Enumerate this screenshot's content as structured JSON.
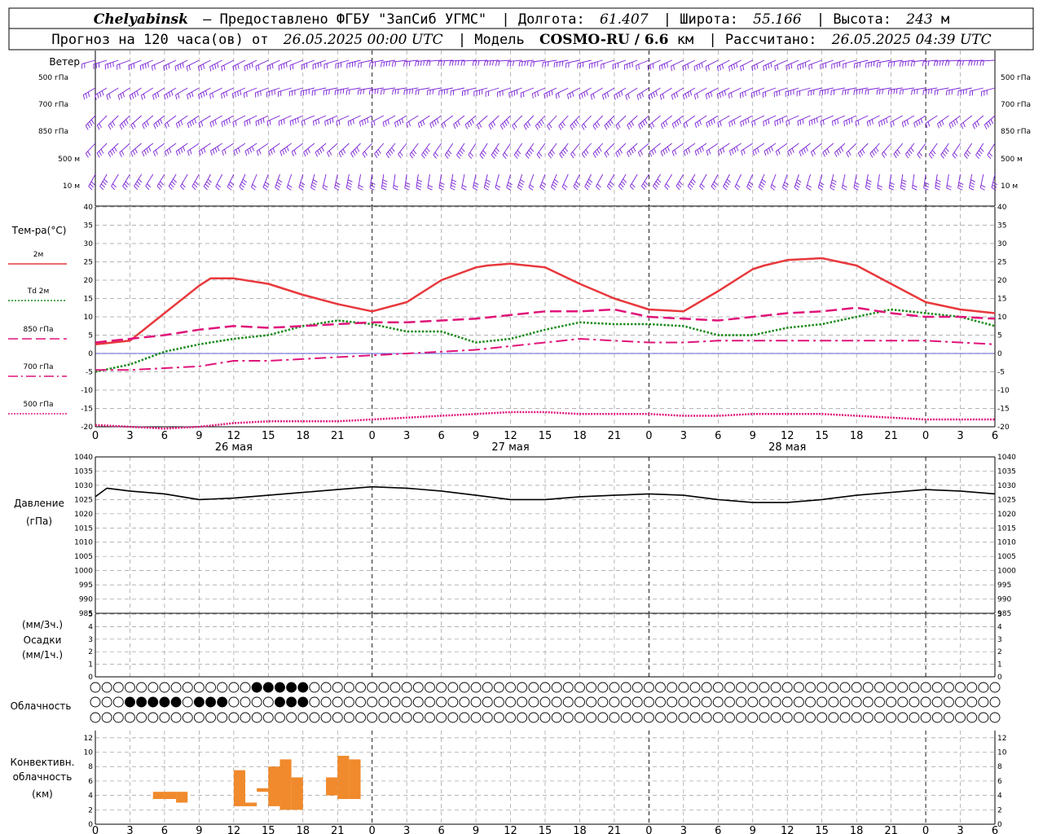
{
  "header": {
    "line1": {
      "station": "Chelyabinsk",
      "provided": "— Предоставлено ФГБУ \"ЗапСиб УГМС\"",
      "lon_label": "| Долгота:",
      "lon": "61.407",
      "lat_label": "| Широта:",
      "lat": "55.166",
      "alt_label": "| Высота:",
      "alt": "243",
      "alt_unit": "м"
    },
    "line2": {
      "forecast": "Прогноз на 120 часа(ов) от",
      "init": "26.05.2025 00:00 UTC",
      "model_label": "| Модель",
      "model": "COSMO-RU / 6.6",
      "model_unit": "км",
      "calc_label": "| Рассчитано:",
      "calc": "26.05.2025 04:39 UTC"
    }
  },
  "panels": {
    "wind": {
      "title": "Ветер",
      "levels": [
        "500 гПа",
        "700 гПа",
        "850 гПа",
        "500 м",
        "10 м"
      ]
    },
    "temperature": {
      "title": "Тем-ра(°C)",
      "legend": [
        {
          "label": "2м",
          "color": "#e8383c",
          "dash": "solid"
        },
        {
          "label": "Td  2м",
          "color": "#1a8a1a",
          "dash": "dot"
        },
        {
          "label": "850 гПа",
          "color": "#e0147a",
          "dash": "longdash"
        },
        {
          "label": "700 гПа",
          "color": "#e0147a",
          "dash": "dashdot"
        },
        {
          "label": "500 гПа",
          "color": "#e0147a",
          "dash": "dense"
        }
      ]
    },
    "pressure": {
      "title": "Давление",
      "unit": "(гПа)"
    },
    "precip": {
      "title": "Осадки",
      "unit_top": "(мм/3ч.)",
      "unit_bottom": "(мм/1ч.)"
    },
    "clouds": {
      "title": "Облачность"
    },
    "convective": {
      "title_1": "Конвективн.",
      "title_2": "облачность",
      "unit": "(км)"
    }
  },
  "x_ticks": [
    "0",
    "3",
    "6",
    "9",
    "12",
    "15",
    "18",
    "21",
    "0",
    "3",
    "6",
    "9",
    "12",
    "15",
    "18",
    "21",
    "0",
    "3",
    "6",
    "9",
    "12",
    "15",
    "18",
    "21",
    "0",
    "3",
    "6"
  ],
  "x_dates": [
    "26 мая",
    "27 мая",
    "28 мая"
  ],
  "colors": {
    "wind": "#7a1fd6",
    "t2m": "#e8383c",
    "td": "#1a8a1a",
    "upper": "#e0147a",
    "pressure": "#000000",
    "conv": "#f08a2c",
    "zero": "#3333cc"
  },
  "chart_data": [
    {
      "type": "line",
      "title": "Тем-ра(°C)",
      "x_unit": "hours since 26.05.2025 00:00 UTC",
      "ylim": [
        -20,
        40
      ],
      "yticks": [
        -20,
        -15,
        -10,
        -5,
        0,
        5,
        10,
        15,
        20,
        25,
        30,
        35,
        40
      ],
      "grid": true,
      "series": [
        {
          "name": "2м",
          "x": [
            0,
            3,
            6,
            9,
            10,
            12,
            15,
            18,
            21,
            24,
            27,
            30,
            33,
            34,
            36,
            39,
            42,
            45,
            48,
            51,
            54,
            57,
            58,
            60,
            63,
            66,
            69,
            72,
            75,
            78
          ],
          "y": [
            2.5,
            3.5,
            11,
            18.5,
            20.5,
            20.5,
            19,
            16,
            13.5,
            11.5,
            14,
            20,
            23.5,
            24,
            24.5,
            23.5,
            19,
            15,
            12,
            11.5,
            17,
            23,
            24,
            25.5,
            26,
            24,
            19,
            14,
            12,
            11
          ]
        },
        {
          "name": "Td  2м",
          "x": [
            0,
            3,
            6,
            9,
            12,
            15,
            18,
            21,
            24,
            27,
            30,
            33,
            36,
            39,
            42,
            45,
            48,
            51,
            54,
            57,
            60,
            63,
            66,
            69,
            72,
            75,
            78
          ],
          "y": [
            -5,
            -3,
            0.5,
            2.5,
            4,
            5,
            7.5,
            9,
            8,
            6,
            6,
            3,
            4,
            6.5,
            8.5,
            8,
            8,
            7.5,
            5,
            5,
            7,
            8,
            10,
            12,
            11,
            10,
            7.5
          ]
        },
        {
          "name": "850 гПа",
          "x": [
            0,
            3,
            6,
            9,
            12,
            15,
            18,
            21,
            24,
            27,
            30,
            33,
            36,
            39,
            42,
            45,
            48,
            51,
            54,
            57,
            60,
            63,
            66,
            69,
            72,
            75,
            78
          ],
          "y": [
            3,
            4,
            5,
            6.5,
            7.5,
            7,
            7.5,
            8,
            8.5,
            8.5,
            9,
            9.5,
            10.5,
            11.5,
            11.5,
            12,
            10,
            9.5,
            9,
            10,
            11,
            11.5,
            12.5,
            11,
            10,
            10,
            9.5
          ]
        },
        {
          "name": "700 гПа",
          "x": [
            0,
            3,
            6,
            9,
            12,
            15,
            18,
            21,
            24,
            27,
            30,
            33,
            36,
            39,
            42,
            45,
            48,
            51,
            54,
            57,
            60,
            63,
            66,
            69,
            72,
            75,
            78
          ],
          "y": [
            -4.5,
            -4.5,
            -4,
            -3.5,
            -2,
            -2,
            -1.5,
            -1,
            -0.5,
            0,
            0.5,
            1,
            2,
            3,
            4,
            3.5,
            3,
            3,
            3.5,
            3.5,
            3.5,
            3.5,
            3.5,
            3.5,
            3.5,
            3,
            2.5
          ]
        },
        {
          "name": "500 гПа",
          "x": [
            0,
            3,
            6,
            9,
            12,
            15,
            18,
            21,
            24,
            27,
            30,
            33,
            36,
            39,
            42,
            45,
            48,
            51,
            54,
            57,
            60,
            63,
            66,
            69,
            72,
            75,
            78
          ],
          "y": [
            -19.5,
            -20,
            -20.5,
            -20,
            -19,
            -18.5,
            -18.5,
            -18.5,
            -18,
            -17.5,
            -17,
            -16.5,
            -16,
            -16,
            -16.5,
            -16.5,
            -16.5,
            -17,
            -17,
            -16.5,
            -16.5,
            -16.5,
            -17,
            -17.5,
            -18,
            -18,
            -18
          ]
        }
      ]
    },
    {
      "type": "line",
      "title": "Давление",
      "x_unit": "hours since 26.05.2025 00:00 UTC",
      "ylim": [
        985,
        1040
      ],
      "yticks": [
        985,
        990,
        995,
        1000,
        1005,
        1010,
        1015,
        1020,
        1025,
        1030,
        1035,
        1040
      ],
      "grid": true,
      "series": [
        {
          "name": "",
          "x": [
            0,
            1,
            3,
            6,
            9,
            12,
            15,
            18,
            21,
            24,
            27,
            30,
            33,
            36,
            39,
            42,
            45,
            48,
            51,
            54,
            57,
            60,
            63,
            66,
            69,
            72,
            75,
            78
          ],
          "y": [
            1026,
            1029,
            1028,
            1027,
            1025,
            1025.5,
            1026.5,
            1027.5,
            1028.5,
            1029.5,
            1029,
            1028,
            1026.5,
            1025,
            1025,
            1026,
            1026.5,
            1027,
            1026.5,
            1025,
            1024,
            1024,
            1025,
            1026.5,
            1027.5,
            1028.5,
            1028,
            1027
          ]
        }
      ]
    },
    {
      "type": "bar",
      "title": "Осадки",
      "ylim": [
        0,
        5
      ],
      "yticks": [
        0,
        1,
        2,
        3,
        4,
        5
      ],
      "grid": true,
      "series": []
    },
    {
      "type": "bar",
      "title": "Конвективн. облачность",
      "unit": "км",
      "ylim": [
        0,
        13
      ],
      "yticks": [
        0,
        2,
        4,
        6,
        8,
        10,
        12
      ],
      "grid": true,
      "bars": [
        {
          "x0": 5,
          "x1": 6,
          "base": 3.5,
          "top": 4.5
        },
        {
          "x0": 6,
          "x1": 7,
          "base": 3.5,
          "top": 4.5
        },
        {
          "x0": 7,
          "x1": 8,
          "base": 3,
          "top": 4.5
        },
        {
          "x0": 12,
          "x1": 13,
          "base": 2.5,
          "top": 7.5
        },
        {
          "x0": 13,
          "x1": 14,
          "base": 2.5,
          "top": 3
        },
        {
          "x0": 14,
          "x1": 15,
          "base": 4.5,
          "top": 5
        },
        {
          "x0": 15,
          "x1": 16,
          "base": 2.5,
          "top": 8
        },
        {
          "x0": 16,
          "x1": 17,
          "base": 2,
          "top": 9
        },
        {
          "x0": 17,
          "x1": 18,
          "base": 2,
          "top": 6.5
        },
        {
          "x0": 20,
          "x1": 21,
          "base": 4,
          "top": 6.5
        },
        {
          "x0": 21,
          "x1": 22,
          "base": 3.5,
          "top": 9.5
        },
        {
          "x0": 22,
          "x1": 23,
          "base": 3.5,
          "top": 9
        }
      ]
    }
  ]
}
